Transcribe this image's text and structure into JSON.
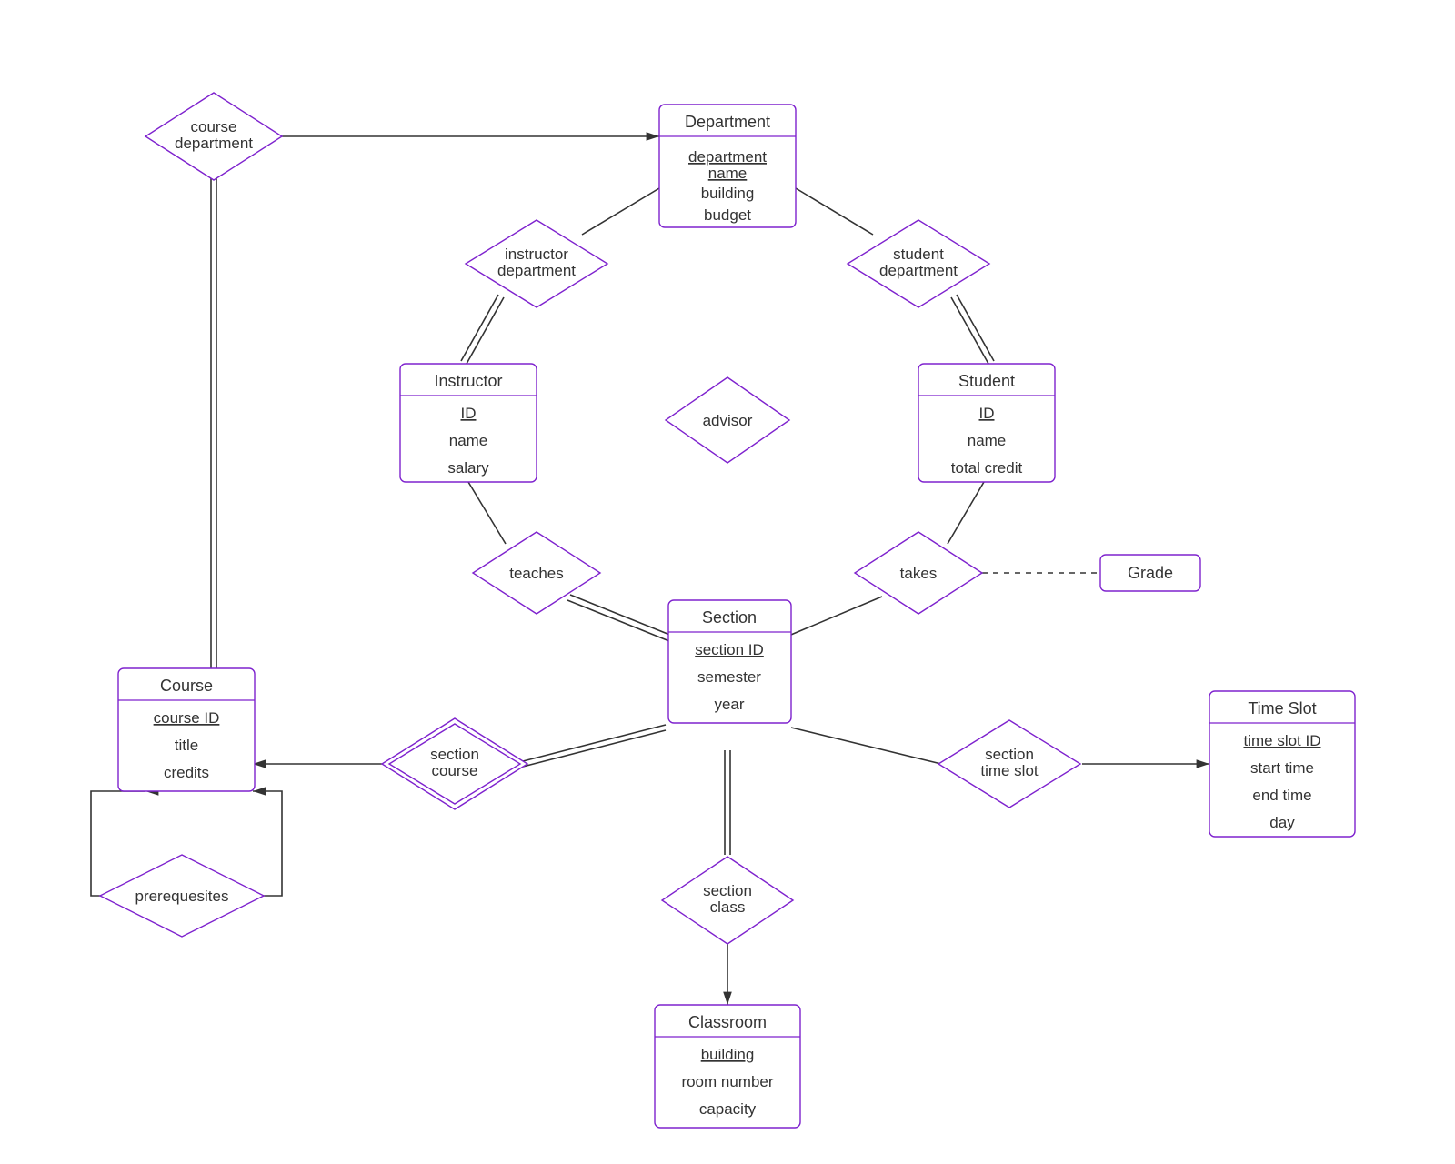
{
  "entities": {
    "department": {
      "title": "Department",
      "attrs": [
        "department name",
        "building",
        "budget"
      ],
      "key": 0
    },
    "instructor": {
      "title": "Instructor",
      "attrs": [
        "ID",
        "name",
        "salary"
      ],
      "key": 0
    },
    "student": {
      "title": "Student",
      "attrs": [
        "ID",
        "name",
        "total credit"
      ],
      "key": 0
    },
    "section": {
      "title": "Section",
      "attrs": [
        "section ID",
        "semester",
        "year"
      ],
      "key": 0
    },
    "course": {
      "title": "Course",
      "attrs": [
        "course ID",
        "title",
        "credits"
      ],
      "key": 0
    },
    "classroom": {
      "title": "Classroom",
      "attrs": [
        "building",
        "room number",
        "capacity"
      ],
      "key": 0
    },
    "timeslot": {
      "title": "Time Slot",
      "attrs": [
        "time slot ID",
        "start time",
        "end time",
        "day"
      ],
      "key": 0
    }
  },
  "relationships": {
    "course_department": {
      "lines": [
        "course",
        "department"
      ]
    },
    "instructor_department": {
      "lines": [
        "instructor",
        "department"
      ]
    },
    "student_department": {
      "lines": [
        "student",
        "department"
      ]
    },
    "advisor": {
      "lines": [
        "advisor"
      ]
    },
    "teaches": {
      "lines": [
        "teaches"
      ]
    },
    "takes": {
      "lines": [
        "takes"
      ]
    },
    "section_course": {
      "lines": [
        "section",
        "course"
      ]
    },
    "section_time_slot": {
      "lines": [
        "section",
        "time slot"
      ]
    },
    "section_class": {
      "lines": [
        "section",
        "class"
      ]
    },
    "prerequisites": {
      "lines": [
        "prerequesites"
      ]
    },
    "grade": {
      "lines": [
        "Grade"
      ]
    }
  },
  "colors": {
    "border": "#7e22ce",
    "line": "#333333",
    "bg": "#ffffff"
  }
}
